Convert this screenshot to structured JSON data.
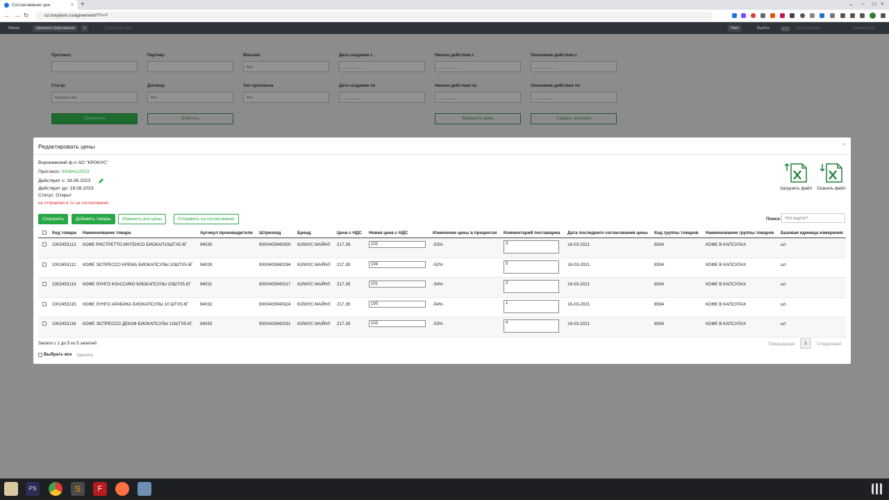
{
  "browser": {
    "tab_title": "Согласование цен",
    "tab_close": "×",
    "new_tab": "+",
    "url": "oz.tvoydom.ru/agreement/?Y=Y",
    "win_min": "–",
    "win_max": "▭",
    "win_close": "×",
    "win_restore": "⌄"
  },
  "appbar": {
    "menu": "Меню",
    "admin": "Администрирование",
    "counter": "2",
    "reset": "Сбросить кеш",
    "user": "Имя",
    "logout": "Выйти",
    "registry": "Регистрация",
    "recall": "Развернуть"
  },
  "filters": {
    "protocol": "Протокол",
    "partner": "Партнер",
    "shops": "Магазин",
    "shops_value": "Все",
    "created_from": "Дата создания с",
    "start_from": "Начало действия с",
    "end_from": "Окончание действия с",
    "date_placeholder": "__.__.____",
    "status": "Статус",
    "status_value": "Выбрать все",
    "contract": "Договор",
    "contract_value": "Все",
    "protocol_type": "Тип протокола",
    "protocol_type_value": "Все",
    "created_to": "Дата создания по",
    "start_to": "Начало действия по",
    "end_to": "Окончание действия по",
    "apply": "Применить",
    "clear": "Очистить",
    "export_prices": "Выгрузить цены",
    "create_protocol": "Создать протокол"
  },
  "modal": {
    "title": "Редактировать цены",
    "close": "×",
    "company": "Воронежский ф-л АО \"КРОКУС\"",
    "protocol_label": "Протокол:",
    "protocol_value": "000641/2023",
    "valid_from": "Действует с: 18.08.2023",
    "valid_to": "Действует до: 18.08.2023",
    "status": "Статус: Открыт",
    "warning": "не отправлен в 1с на согласование",
    "upload_file": "Загрузить файл",
    "download_file": "Скачать файл",
    "save": "Сохранить",
    "add_goods": "Добавить товары",
    "change_all": "Изменить все цены",
    "send_approval": "Отправить на согласование",
    "search_label": "Поиск:",
    "search_placeholder": "Что ищете?",
    "records": "Записи с 1 до 5 из 5 записей",
    "select_all": "Выбрать все",
    "delete": "Удалить",
    "prev": "Предыдущая",
    "page": "1",
    "next": "Следующая"
  },
  "table": {
    "headers": [
      "Код товара",
      "Наименование товара",
      "Артикул производителя",
      "Штрихкод",
      "Бренд",
      "Цена с НДС",
      "Новая цена с НДС",
      "Изменение цены в процентах",
      "Комментарий поставщика",
      "Дата последнего согласования цены",
      "Код группы товаров",
      "Наименование группы товаров",
      "Базовая единица измерения"
    ],
    "rows": [
      [
        "1002453113",
        "КОФЕ РИСТРЕТТО ИНТЕНСО БИОКАП10ШТХ5.6Г",
        "94030",
        "9000403940300",
        "ЮЛИУС МАЙНЛ",
        "217.39",
        "102",
        "-53%",
        "3",
        "16-03-2021",
        "8934",
        "КОФЕ В КАПСУЛАХ",
        "шт"
      ],
      [
        "1002453112",
        "КОФЕ ЭСПРЕССО КРЕМА БИОКАПСУЛЫ 10ШТХ5.6Г",
        "94029",
        "9000403940294",
        "ЮЛИУС МАЙНЛ",
        "217.39",
        "104",
        "-52%",
        "5",
        "16-03-2021",
        "8934",
        "КОФЕ В КАПСУЛАХ",
        "шт"
      ],
      [
        "1002453114",
        "КОФЕ ЛУНГО КЛАССИКО БИОКАПСУЛЫ 10ШТХ5.6Г",
        "94031",
        "9000403940317",
        "ЮЛИУС МАЙНЛ",
        "217.39",
        "101",
        "-54%",
        "2",
        "16-03-2021",
        "8934",
        "КОФЕ В КАПСУЛАХ",
        "шт"
      ],
      [
        "1002453115",
        "КОФЕ ЛУНГО АРАБИКА БИОКАПСУЛЫ 10 ШТХ5.6Г",
        "94032",
        "9000403940324",
        "ЮЛИУС МАЙНЛ",
        "217.39",
        "100",
        "-54%",
        "1",
        "16-03-2021",
        "8934",
        "КОФЕ В КАПСУЛАХ",
        "шт"
      ],
      [
        "1002453116",
        "КОФЕ ЭСПРЕССО ДЕКАФ БИОКАПСУЛЫ 10ШТХ5.6Г",
        "94033",
        "9000403940331",
        "ЮЛИУС МАЙНЛ",
        "217.39",
        "103",
        "-53%",
        "4",
        "16-03-2021",
        "8934",
        "КОФЕ В КАПСУЛАХ",
        "шт"
      ]
    ]
  },
  "colors": {
    "accent": "#28a745",
    "warning": "#e03030",
    "navbar": "#2d3338"
  }
}
